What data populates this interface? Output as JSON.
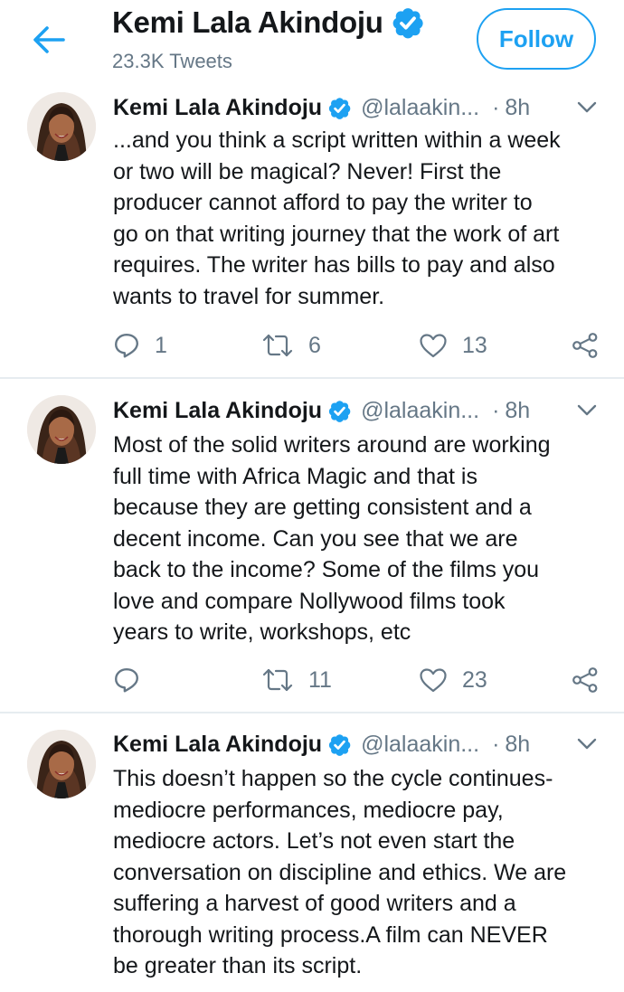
{
  "header": {
    "name": "Kemi Lala Akindoju",
    "tweet_count": "23.3K Tweets",
    "follow_label": "Follow"
  },
  "colors": {
    "accent": "#1da1f2",
    "secondary_text": "#657786",
    "divider": "#e6ecf0",
    "text": "#14171a"
  },
  "icons": {
    "back": "arrow-left-icon",
    "verified": "verified-badge-icon",
    "caret": "chevron-down-icon",
    "reply": "reply-icon",
    "retweet": "retweet-icon",
    "like": "heart-icon",
    "share": "share-icon"
  },
  "tweets": [
    {
      "name": "Kemi Lala Akindoju",
      "handle": "@lalaakin...",
      "dot": "·",
      "time": "8h",
      "lines": [
        "...and you think a script written within a week",
        "or two will be magical? Never! First the",
        "producer cannot afford to pay the writer to",
        "go on that writing journey that the work of art",
        "requires. The writer has bills to pay and also",
        "wants to travel for summer."
      ],
      "replies": "1",
      "retweets": "6",
      "likes": "13"
    },
    {
      "name": "Kemi Lala Akindoju",
      "handle": "@lalaakin...",
      "dot": "·",
      "time": "8h",
      "lines": [
        "Most of the solid writers around are working",
        "full time with Africa Magic and that is",
        "because they are getting consistent and a",
        "decent income. Can you see that we are",
        "back to the income? Some of the films you",
        "love and compare Nollywood films took",
        "years to write, workshops, etc"
      ],
      "replies": "",
      "retweets": "11",
      "likes": "23"
    },
    {
      "name": "Kemi Lala Akindoju",
      "handle": "@lalaakin...",
      "dot": "·",
      "time": "8h",
      "lines": [
        "This doesn’t happen so the cycle continues-",
        "mediocre performances, mediocre pay,",
        "mediocre actors. Let’s not even start the",
        "conversation on discipline and ethics. We are",
        "suffering a harvest of good writers and a",
        "thorough writing process.A film can NEVER",
        "be greater than its script."
      ]
    }
  ]
}
